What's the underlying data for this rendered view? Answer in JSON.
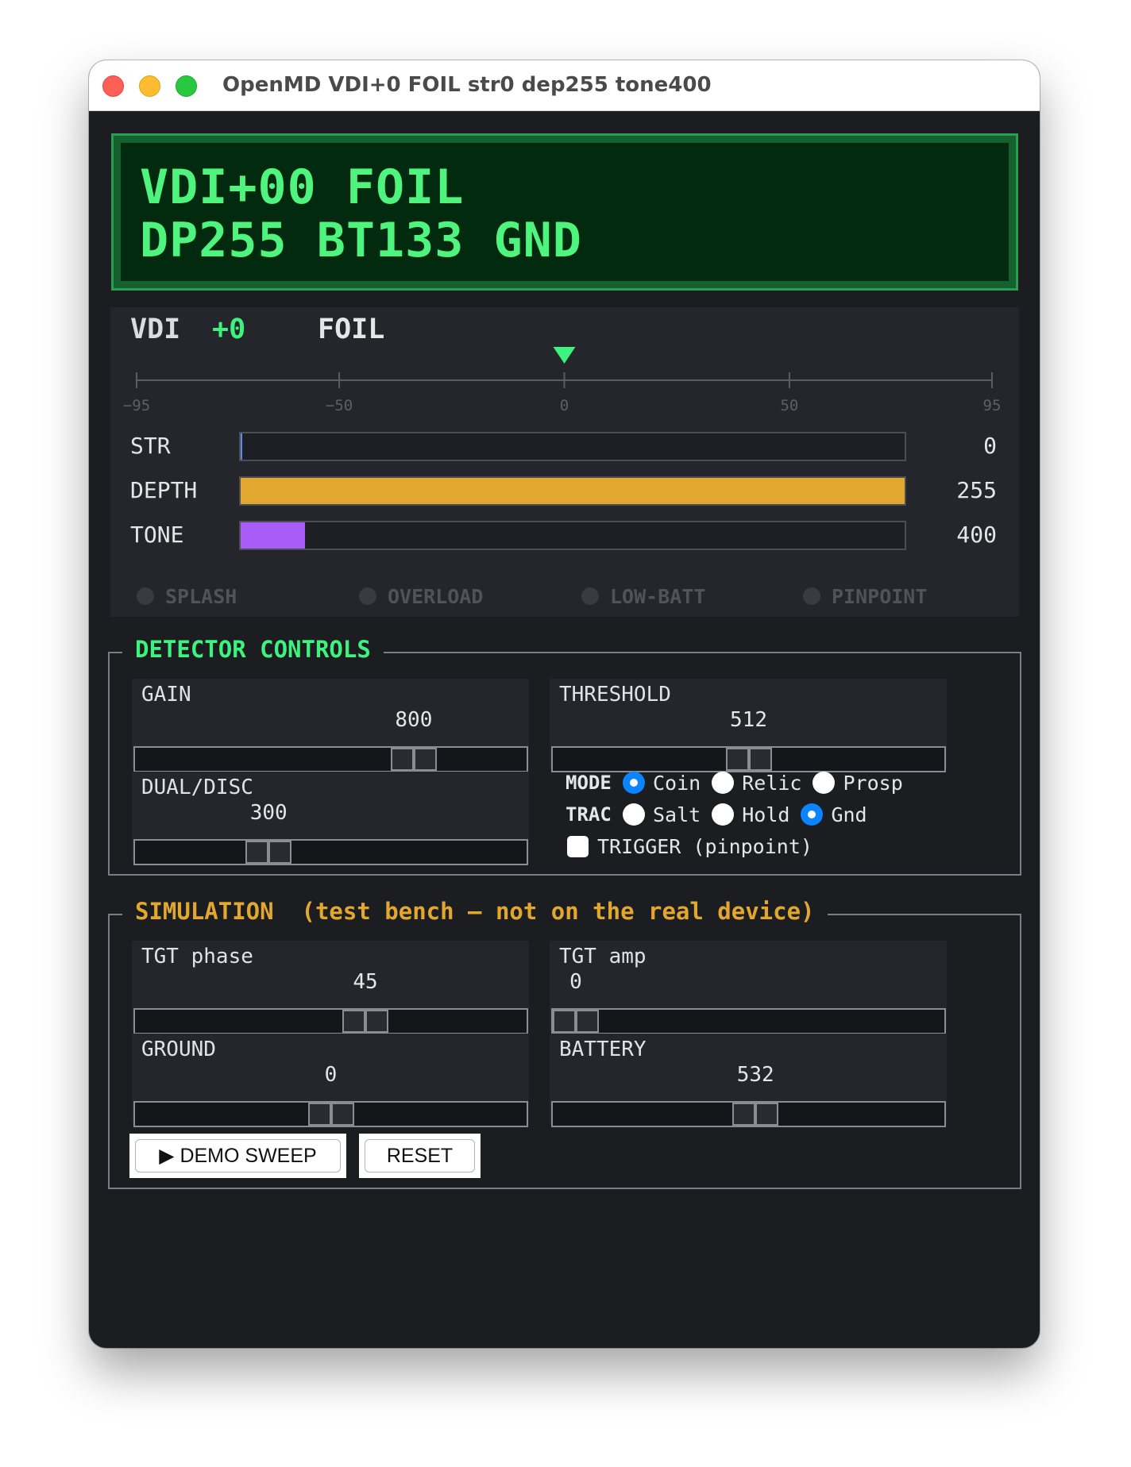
{
  "window": {
    "title": "OpenMD  VDI+0 FOIL str0 dep255 tone400"
  },
  "lcd": {
    "line1": "VDI+00 FOIL",
    "line2": "DP255 BT133 GND",
    "text_color": "#4ff47f",
    "background": "#012a0e"
  },
  "meter": {
    "vdi_label": "VDI",
    "vdi_value": "+0",
    "vdi_numeric": 0,
    "target_class": "FOIL",
    "scale": {
      "min": -95,
      "max": 95,
      "ticks": [
        "−95",
        "−50",
        "0",
        "50",
        "95"
      ],
      "tick_values": [
        -95,
        -50,
        0,
        50,
        95
      ]
    },
    "marker_color": "#3ef27e",
    "bars": [
      {
        "label": "STR",
        "value": "0",
        "fraction": 0,
        "color": "#5b8def"
      },
      {
        "label": "DEPTH",
        "value": "255",
        "fraction": 1.0,
        "color": "#e2a72e"
      },
      {
        "label": "TONE",
        "value": "400",
        "fraction": 0.097,
        "color": "#a95cf7"
      }
    ],
    "indicators": [
      {
        "label": "SPLASH",
        "active": false
      },
      {
        "label": "OVERLOAD",
        "active": false
      },
      {
        "label": "LOW-BATT",
        "active": false
      },
      {
        "label": "PINPOINT",
        "active": false
      }
    ]
  },
  "detector_controls": {
    "legend": "DETECTOR CONTROLS",
    "legend_color": "#3ef27e",
    "sliders": {
      "gain": {
        "label": "GAIN",
        "value": "800",
        "fraction": 0.74
      },
      "threshold": {
        "label": "THRESHOLD",
        "value": "512",
        "fraction": 0.5
      },
      "dual_disc": {
        "label": "DUAL/DISC",
        "value": "300",
        "fraction": 0.32
      }
    },
    "mode": {
      "key": "MODE",
      "options": [
        {
          "label": "Coin",
          "selected": true
        },
        {
          "label": "Relic",
          "selected": false
        },
        {
          "label": "Prosp",
          "selected": false
        }
      ]
    },
    "trac": {
      "key": "TRAC",
      "options": [
        {
          "label": "Salt",
          "selected": false
        },
        {
          "label": "Hold",
          "selected": false
        },
        {
          "label": "Gnd",
          "selected": true
        }
      ]
    },
    "trigger": {
      "label": "TRIGGER (pinpoint)",
      "checked": false
    }
  },
  "simulation": {
    "legend": "SIMULATION  (test bench – not on the real device)",
    "legend_color": "#e2a72e",
    "sliders": {
      "tgt_phase": {
        "label": "TGT phase",
        "value": "45",
        "fraction": 0.6
      },
      "tgt_amp": {
        "label": "TGT amp",
        "value": "0",
        "fraction": 0.0
      },
      "ground": {
        "label": "GROUND",
        "value": "0",
        "fraction": 0.5
      },
      "battery": {
        "label": "BATTERY",
        "value": "532",
        "fraction": 0.52
      }
    },
    "buttons": {
      "demo_sweep": "▶ DEMO SWEEP",
      "reset": "RESET"
    }
  }
}
